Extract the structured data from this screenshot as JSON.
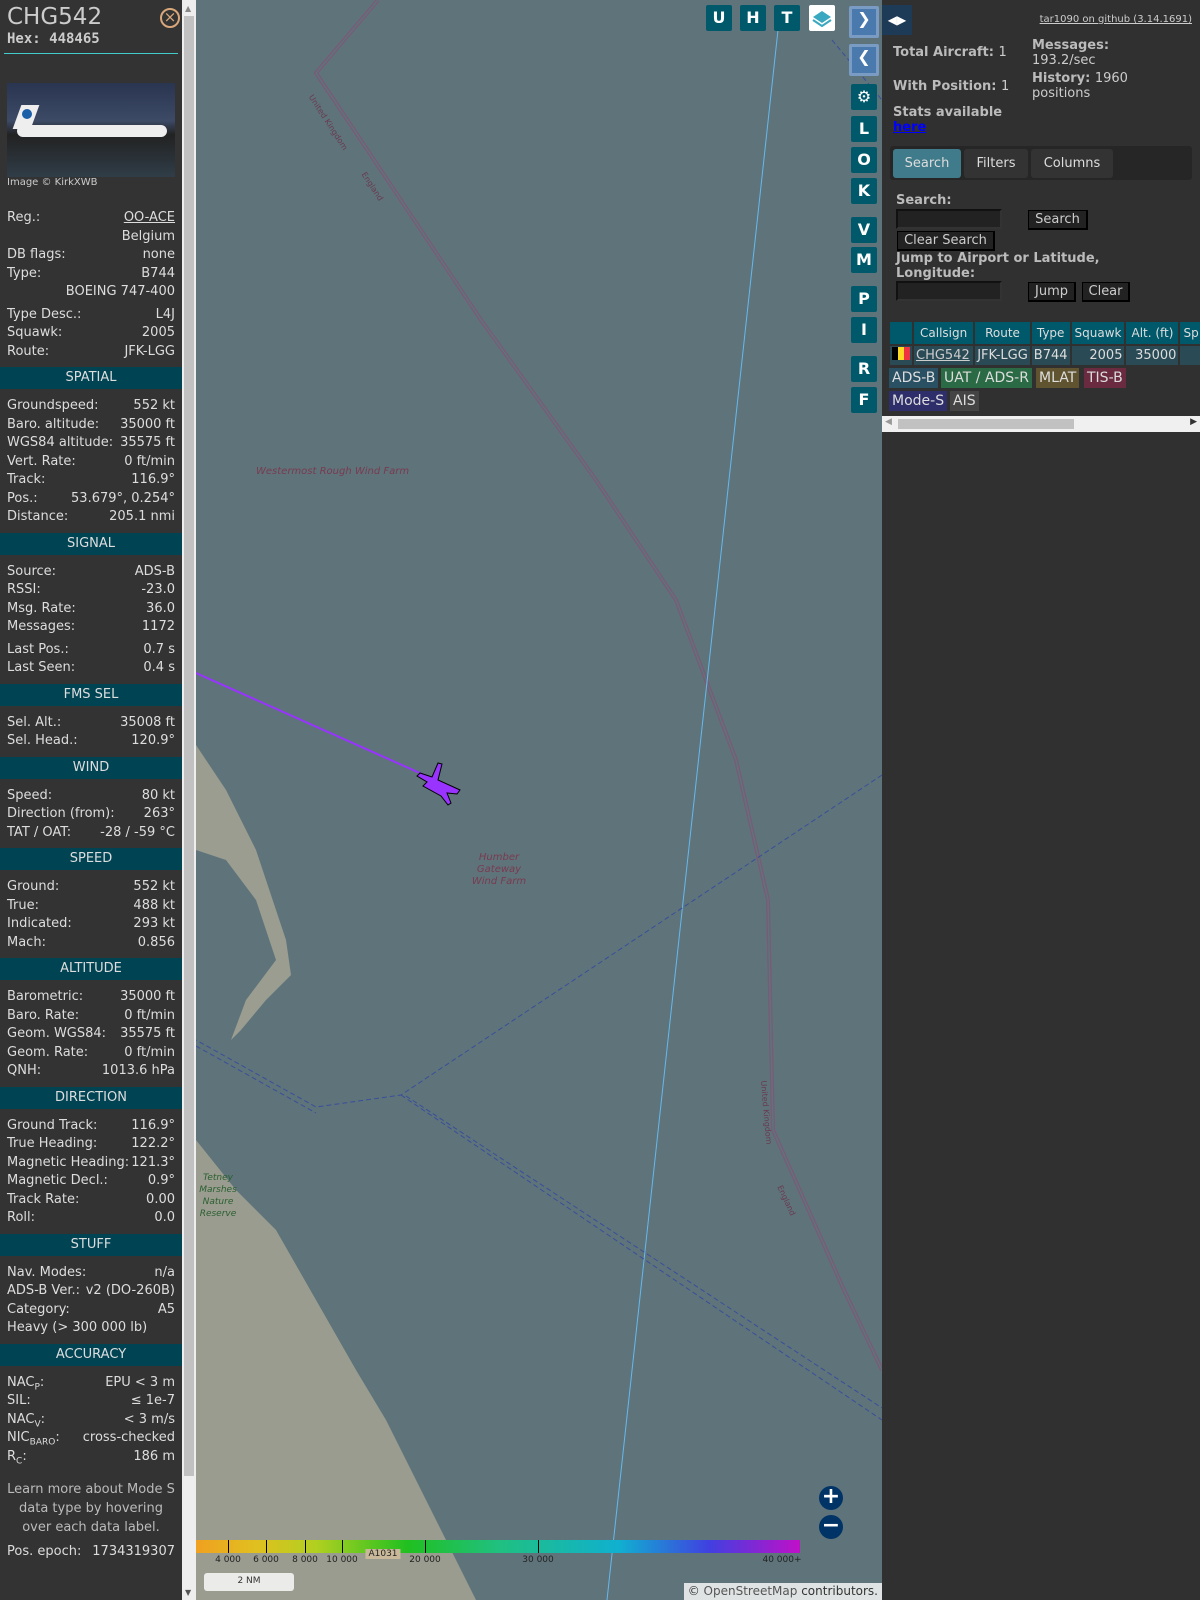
{
  "aircraft": {
    "callsign": "CHG542",
    "hex": "Hex: 448465",
    "photo_credit": "Image © KirkXWB"
  },
  "top_rows": [
    {
      "label": "Reg.:",
      "value": "OO-ACE",
      "link": true
    },
    {
      "label": "",
      "value": "Belgium"
    },
    {
      "label": "DB flags:",
      "value": "none"
    },
    {
      "label": "Type:",
      "value": "B744"
    },
    {
      "label": "",
      "value": "BOEING 747-400"
    },
    {
      "label": "Type Desc.:",
      "value": "L4J",
      "gap": true
    },
    {
      "label": "Squawk:",
      "value": "2005"
    },
    {
      "label": "Route:",
      "value": "JFK-LGG"
    }
  ],
  "sections": [
    {
      "title": "SPATIAL",
      "rows": [
        {
          "label": "Groundspeed:",
          "value": "552 kt"
        },
        {
          "label": "Baro. altitude:",
          "value": "35000 ft"
        },
        {
          "label": "WGS84 altitude:",
          "value": "35575 ft"
        },
        {
          "label": "Vert. Rate:",
          "value": "0 ft/min"
        },
        {
          "label": "Track:",
          "value": "116.9°"
        },
        {
          "label": "Pos.:",
          "value": "53.679°, 0.254°"
        },
        {
          "label": "Distance:",
          "value": "205.1 nmi"
        }
      ]
    },
    {
      "title": "SIGNAL",
      "rows": [
        {
          "label": "Source:",
          "value": "ADS-B"
        },
        {
          "label": "RSSI:",
          "value": "-23.0"
        },
        {
          "label": "Msg. Rate:",
          "value": "36.0"
        },
        {
          "label": "Messages:",
          "value": "1172"
        },
        {
          "label": "Last Pos.:",
          "value": "0.7 s",
          "gap": true
        },
        {
          "label": "Last Seen:",
          "value": "0.4 s"
        }
      ]
    },
    {
      "title": "FMS SEL",
      "rows": [
        {
          "label": "Sel. Alt.:",
          "value": "35008 ft"
        },
        {
          "label": "Sel. Head.:",
          "value": "120.9°"
        }
      ]
    },
    {
      "title": "WIND",
      "rows": [
        {
          "label": "Speed:",
          "value": "80 kt"
        },
        {
          "label": "Direction (from):",
          "value": "263°"
        },
        {
          "label": "TAT / OAT:",
          "value": "-28 / -59 °C"
        }
      ]
    },
    {
      "title": "SPEED",
      "rows": [
        {
          "label": "Ground:",
          "value": "552 kt"
        },
        {
          "label": "True:",
          "value": "488 kt"
        },
        {
          "label": "Indicated:",
          "value": "293 kt"
        },
        {
          "label": "Mach:",
          "value": "0.856"
        }
      ]
    },
    {
      "title": "ALTITUDE",
      "rows": [
        {
          "label": "Barometric:",
          "value": "35000 ft"
        },
        {
          "label": "Baro. Rate:",
          "value": "0 ft/min"
        },
        {
          "label": "Geom. WGS84:",
          "value": "35575 ft"
        },
        {
          "label": "Geom. Rate:",
          "value": "0 ft/min"
        },
        {
          "label": "QNH:",
          "value": "1013.6 hPa"
        }
      ]
    },
    {
      "title": "DIRECTION",
      "rows": [
        {
          "label": "Ground Track:",
          "value": "116.9°"
        },
        {
          "label": "True Heading:",
          "value": "122.2°"
        },
        {
          "label": "Magnetic Heading:",
          "value": "121.3°"
        },
        {
          "label": "Magnetic Decl.:",
          "value": "0.9°"
        },
        {
          "label": "Track Rate:",
          "value": "0.00"
        },
        {
          "label": "Roll:",
          "value": "0.0"
        }
      ]
    },
    {
      "title": "STUFF",
      "rows": [
        {
          "label": "Nav. Modes:",
          "value": "n/a"
        },
        {
          "label": "ADS-B Ver.:",
          "value": "v2 (DO-260B)"
        },
        {
          "label": "Category:",
          "value": "A5"
        },
        {
          "label": "Heavy (> 300 000 lb)",
          "value": ""
        }
      ]
    },
    {
      "title": "ACCURACY",
      "rows": [
        {
          "label": "NAC",
          "sub": "P",
          "value": "EPU < 3 m"
        },
        {
          "label": "SIL:",
          "value": "≤ 1e-7"
        },
        {
          "label": "NAC",
          "sub": "V",
          "value": "< 3 m/s"
        },
        {
          "label": "NIC",
          "sub": "BARO",
          "value": "cross-checked"
        },
        {
          "label": "R",
          "sub": "C",
          "value": "186 m"
        }
      ]
    }
  ],
  "learn_more": "Learn more about Mode S data type by hovering over each data label.",
  "pos_epoch": {
    "label": "Pos. epoch:",
    "value": "1734319307"
  },
  "map": {
    "labels": {
      "westermost": "Westermost Rough Wind Farm",
      "humber": "Humber Gateway Wind Farm",
      "tetney": "Tetney Marshes Nature Reserve",
      "uk": "United Kingdom",
      "england": "England",
      "road": "A1031"
    },
    "top_buttons": [
      "U",
      "H",
      "T"
    ],
    "side_buttons": [
      "L",
      "O",
      "K",
      "V",
      "M",
      "P",
      "I",
      "R",
      "F"
    ],
    "altitude_ticks": [
      "4 000",
      "6 000",
      "8 000",
      "10 000",
      "20 000",
      "30 000",
      "40 000+"
    ],
    "scale": "2 NM",
    "attribution_prefix": "©",
    "attribution_link": "OpenStreetMap",
    "attribution_suffix": "contributors.",
    "trail_color": "#9933ff"
  },
  "right": {
    "github": "tar1090 on github (3.14.1691)",
    "total_aircraft_label": "Total Aircraft:",
    "total_aircraft": "1",
    "with_position_label": "With Position:",
    "with_position": "1",
    "messages_label": "Messages:",
    "messages": "193.2/sec",
    "history_label": "History:",
    "history": "1960 positions",
    "stats_label": "Stats available",
    "stats_link": "here",
    "tabs": [
      "Search",
      "Filters",
      "Columns"
    ],
    "search_label": "Search:",
    "search_value": "",
    "search_btn": "Search",
    "clear_search_btn": "Clear Search",
    "jump_label": "Jump to Airport or Latitude, Longitude:",
    "jump_value": "",
    "jump_btn": "Jump",
    "clear_btn": "Clear",
    "columns": [
      "",
      "Callsign",
      "Route",
      "Type",
      "Squawk",
      "Alt. (ft)",
      "Sp"
    ],
    "rows": [
      {
        "flag": "Belgium",
        "callsign": "CHG542",
        "route": "JFK-LGG",
        "type": "B744",
        "squawk": "2005",
        "alt": "35000",
        "speed": ""
      }
    ],
    "badges": [
      {
        "label": "ADS-B",
        "color": "#2a5064"
      },
      {
        "label": "UAT / ADS-R",
        "color": "#2a6a44"
      },
      {
        "label": "MLAT",
        "color": "#605430"
      },
      {
        "label": "TIS-B",
        "color": "#6a2a40"
      },
      {
        "label": "Mode-S",
        "color": "#2e2e6a"
      },
      {
        "label": "AIS",
        "color": "#444444"
      }
    ]
  }
}
